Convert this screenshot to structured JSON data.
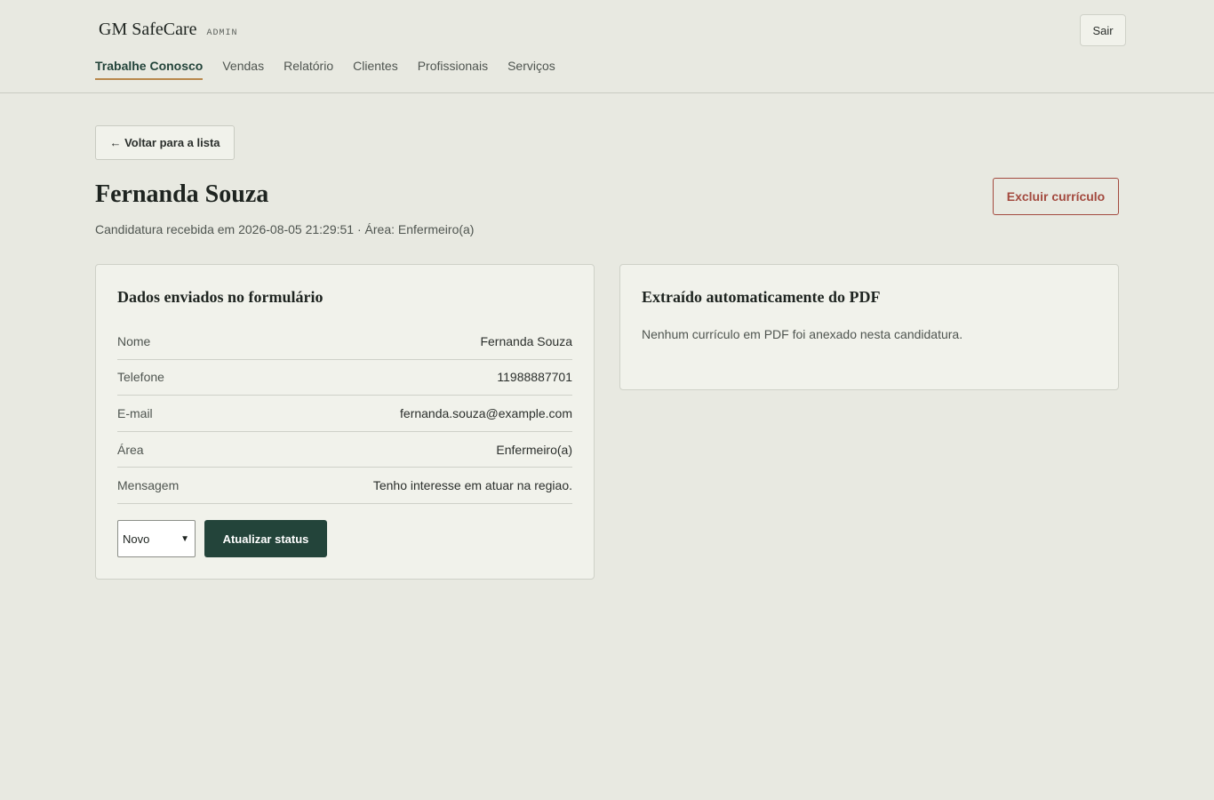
{
  "header": {
    "brand": "GM SafeCare",
    "tag": "ADMIN",
    "logout_label": "Sair",
    "nav": [
      {
        "label": "Trabalhe Conosco",
        "active": true
      },
      {
        "label": "Vendas"
      },
      {
        "label": "Relatório"
      },
      {
        "label": "Clientes"
      },
      {
        "label": "Profissionais"
      },
      {
        "label": "Serviços"
      }
    ]
  },
  "page": {
    "back_label": "← Voltar para a lista",
    "title": "Fernanda Souza",
    "subtitle": "Candidatura recebida em 2026-08-05 21:29:51 · Área: Enfermeiro(a)",
    "delete_label": "Excluir currículo"
  },
  "form_card": {
    "title": "Dados enviados no formulário",
    "rows": [
      {
        "label": "Nome",
        "value": "Fernanda Souza"
      },
      {
        "label": "Telefone",
        "value": "11988887701"
      },
      {
        "label": "E-mail",
        "value": "fernanda.souza@example.com"
      },
      {
        "label": "Área",
        "value": "Enfermeiro(a)"
      },
      {
        "label": "Mensagem",
        "value": "Tenho interesse em atuar na regiao."
      }
    ],
    "status_selected": "Novo",
    "update_label": "Atualizar status"
  },
  "pdf_card": {
    "title": "Extraído automaticamente do PDF",
    "text": "Nenhum currículo em PDF foi anexado nesta candidatura."
  },
  "colors": {
    "background": "#e8e9e1",
    "card": "#f1f2eb",
    "primary": "#23443a",
    "accent_underline": "#b8874b",
    "danger": "#a34a3f"
  }
}
